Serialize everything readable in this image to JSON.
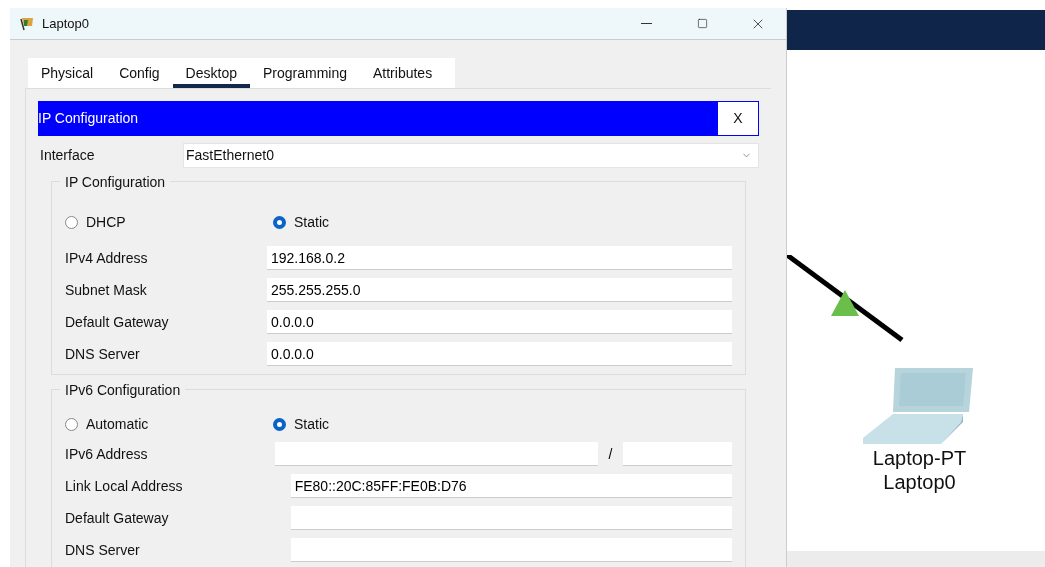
{
  "window": {
    "title": "Laptop0"
  },
  "tabs": [
    {
      "label": "Physical",
      "selected": false
    },
    {
      "label": "Config",
      "selected": false
    },
    {
      "label": "Desktop",
      "selected": true
    },
    {
      "label": "Programming",
      "selected": false
    },
    {
      "label": "Attributes",
      "selected": false
    }
  ],
  "panel": {
    "title": "IP Configuration",
    "close_label": "X"
  },
  "interface": {
    "label": "Interface",
    "value": "FastEthernet0"
  },
  "ipv4": {
    "title": "IP Configuration",
    "modes": [
      {
        "label": "DHCP",
        "selected": false
      },
      {
        "label": "Static",
        "selected": true
      }
    ],
    "fields": [
      {
        "label": "IPv4 Address",
        "value": "192.168.0.2"
      },
      {
        "label": "Subnet Mask",
        "value": "255.255.255.0"
      },
      {
        "label": "Default Gateway",
        "value": "0.0.0.0"
      },
      {
        "label": "DNS Server",
        "value": "0.0.0.0"
      }
    ]
  },
  "ipv6": {
    "title": "IPv6 Configuration",
    "modes": [
      {
        "label": "Automatic",
        "selected": false
      },
      {
        "label": "Static",
        "selected": true
      }
    ],
    "fields": [
      {
        "label": "IPv6 Address",
        "kind": "prefix",
        "separator": "/"
      },
      {
        "label": "Link Local Address",
        "kind": "plain",
        "value": "FE80::20C:85FF:FE0B:D76"
      },
      {
        "label": "Default Gateway",
        "kind": "plain"
      },
      {
        "label": "DNS Server",
        "kind": "plain"
      }
    ]
  },
  "canvas": {
    "device": {
      "model": "Laptop-PT",
      "name": "Laptop0"
    }
  }
}
